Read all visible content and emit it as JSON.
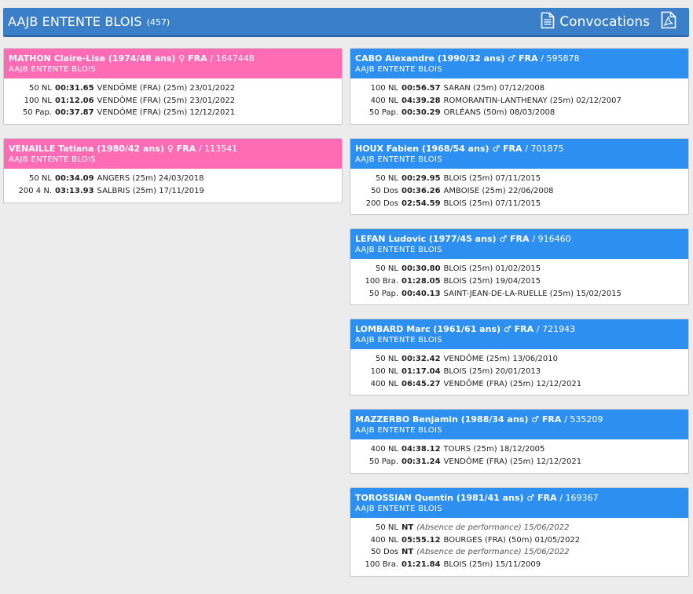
{
  "header": {
    "title": "AAJB ENTENTE BLOIS",
    "count": "(457)",
    "convocations_label": "Convocations",
    "doc_icon": "document-icon",
    "pdf_icon": "pdf-icon"
  },
  "colors": {
    "header": "#3a7fc8",
    "female": "#ff6cb5",
    "male": "#2d8ff0"
  },
  "left_cards": [
    {
      "gender": "female",
      "name": "MATHON Claire-Lise (1974/48 ans) ♀ FRA",
      "license": "/ 1647448",
      "club": "AAJB ENTENTE BLOIS",
      "rows": [
        {
          "event": "50 NL",
          "time": "00:31.65",
          "info": "VENDÔME (FRA) (25m) 23/01/2022"
        },
        {
          "event": "100 NL",
          "time": "01:12.06",
          "info": "VENDÔME (FRA) (25m) 23/01/2022"
        },
        {
          "event": "50 Pap.",
          "time": "00:37.87",
          "info": "VENDÔME (FRA) (25m) 12/12/2021"
        }
      ]
    },
    {
      "gender": "female",
      "name": "VENAILLE Tatiana (1980/42 ans) ♀ FRA",
      "license": "/ 113541",
      "club": "AAJB ENTENTE BLOIS",
      "rows": [
        {
          "event": "50 NL",
          "time": "00:34.09",
          "info": "ANGERS (25m) 24/03/2018"
        },
        {
          "event": "200 4 N.",
          "time": "03:13.93",
          "info": "SALBRIS (25m) 17/11/2019"
        }
      ]
    }
  ],
  "right_cards": [
    {
      "gender": "male",
      "name": "CABO Alexandre (1990/32 ans) ♂ FRA",
      "license": "/ 595878",
      "club": "AAJB ENTENTE BLOIS",
      "rows": [
        {
          "event": "100 NL",
          "time": "00:56.57",
          "info": "SARAN (25m) 07/12/2008"
        },
        {
          "event": "400 NL",
          "time": "04:39.28",
          "info": "ROMORANTIN-LANTHENAY (25m) 02/12/2007"
        },
        {
          "event": "50 Pap.",
          "time": "00:30.29",
          "info": "ORLÉANS (50m) 08/03/2008"
        }
      ]
    },
    {
      "gender": "male",
      "name": "HOUX Fabien (1968/54 ans) ♂ FRA",
      "license": "/ 701875",
      "club": "AAJB ENTENTE BLOIS",
      "rows": [
        {
          "event": "50 NL",
          "time": "00:29.95",
          "info": "BLOIS (25m) 07/11/2015"
        },
        {
          "event": "50 Dos",
          "time": "00:36.26",
          "info": "AMBOISE (25m) 22/06/2008"
        },
        {
          "event": "200 Dos",
          "time": "02:54.59",
          "info": "BLOIS (25m) 07/11/2015"
        }
      ]
    },
    {
      "gender": "male",
      "name": "LEFAN Ludovic (1977/45 ans) ♂ FRA",
      "license": "/ 916460",
      "club": "AAJB ENTENTE BLOIS",
      "rows": [
        {
          "event": "50 NL",
          "time": "00:30.80",
          "info": "BLOIS (25m) 01/02/2015"
        },
        {
          "event": "100 Bra.",
          "time": "01:28.05",
          "info": "BLOIS (25m) 19/04/2015"
        },
        {
          "event": "50 Pap.",
          "time": "00:40.13",
          "info": "SAINT-JEAN-DE-LA-RUELLE (25m) 15/02/2015"
        }
      ]
    },
    {
      "gender": "male",
      "name": "LOMBARD Marc (1961/61 ans) ♂ FRA",
      "license": "/ 721943",
      "club": "AAJB ENTENTE BLOIS",
      "rows": [
        {
          "event": "50 NL",
          "time": "00:32.42",
          "info": "VENDÔME (25m) 13/06/2010"
        },
        {
          "event": "100 NL",
          "time": "01:17.04",
          "info": "BLOIS (25m) 20/01/2013"
        },
        {
          "event": "400 NL",
          "time": "06:45.27",
          "info": "VENDÔME (FRA) (25m) 12/12/2021"
        }
      ]
    },
    {
      "gender": "male",
      "name": "MAZZERBO Benjamin (1988/34 ans) ♂ FRA",
      "license": "/ 535209",
      "club": "AAJB ENTENTE BLOIS",
      "rows": [
        {
          "event": "400 NL",
          "time": "04:38.12",
          "info": "TOURS (25m) 18/12/2005"
        },
        {
          "event": "50 Pap.",
          "time": "00:31.24",
          "info": "VENDÔME (FRA) (25m) 12/12/2021"
        }
      ]
    },
    {
      "gender": "male",
      "name": "TOROSSIAN Quentin (1981/41 ans) ♂ FRA",
      "license": "/ 169367",
      "club": "AAJB ENTENTE BLOIS",
      "rows": [
        {
          "event": "50 NL",
          "time": "NT",
          "info": "",
          "note": "(Absence de performance) 15/06/2022"
        },
        {
          "event": "400 NL",
          "time": "05:55.12",
          "info": "BOURGES (FRA) (50m) 01/05/2022"
        },
        {
          "event": "50 Dos",
          "time": "NT",
          "info": "",
          "note": "(Absence de performance) 15/06/2022"
        },
        {
          "event": "100 Bra.",
          "time": "01:21.84",
          "info": "BLOIS (25m) 15/11/2009"
        }
      ]
    }
  ]
}
